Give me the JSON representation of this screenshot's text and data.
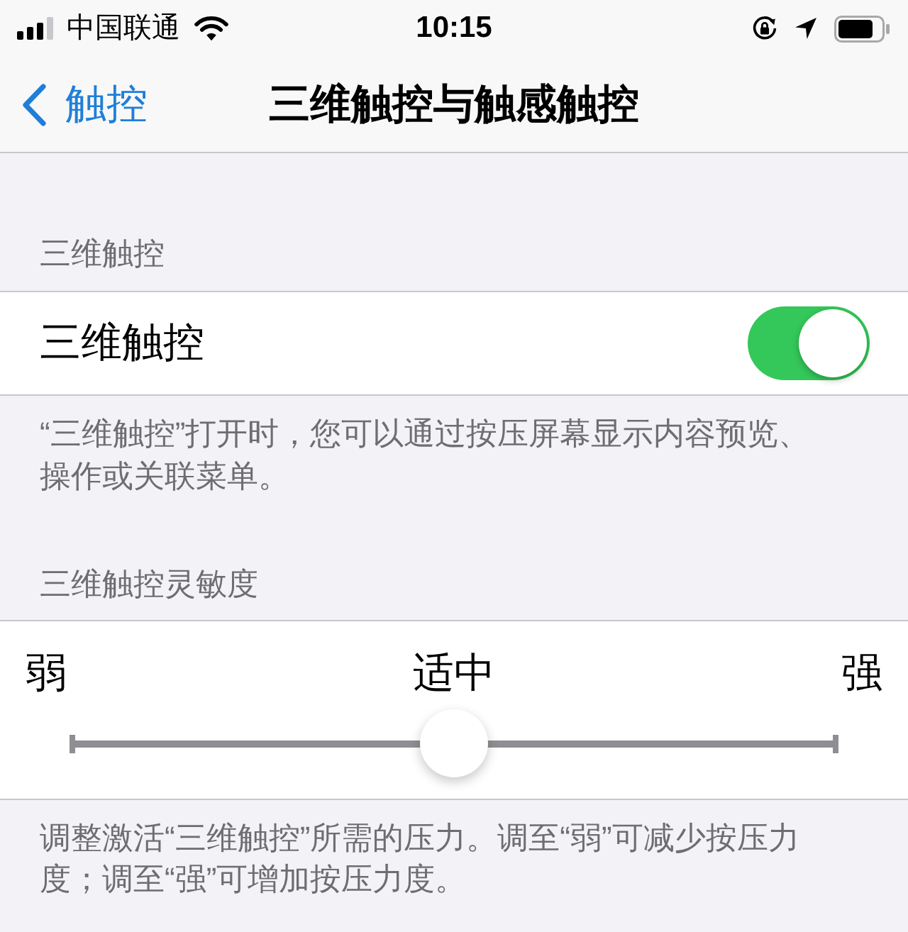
{
  "status_bar": {
    "carrier": "中国联通",
    "time": "10:15"
  },
  "nav_bar": {
    "back_label": "触控",
    "title": "三维触控与触感触控"
  },
  "sections": [
    {
      "kind": "toggle",
      "header": "三维触控",
      "row": {
        "label": "三维触控",
        "on": true
      },
      "footer": "“三维触控”打开时，您可以通过按压屏幕显示内容预览、操作或关联菜单。"
    },
    {
      "kind": "slider",
      "header": "三维触控灵敏度",
      "row": {
        "min_label": "弱",
        "value_label": "适中",
        "max_label": "强",
        "level": 0.5
      },
      "footer": "调整激活“三维触控”所需的压力。调至“弱”可减少按压力度；调至“强”可增加按压力度。"
    }
  ]
}
